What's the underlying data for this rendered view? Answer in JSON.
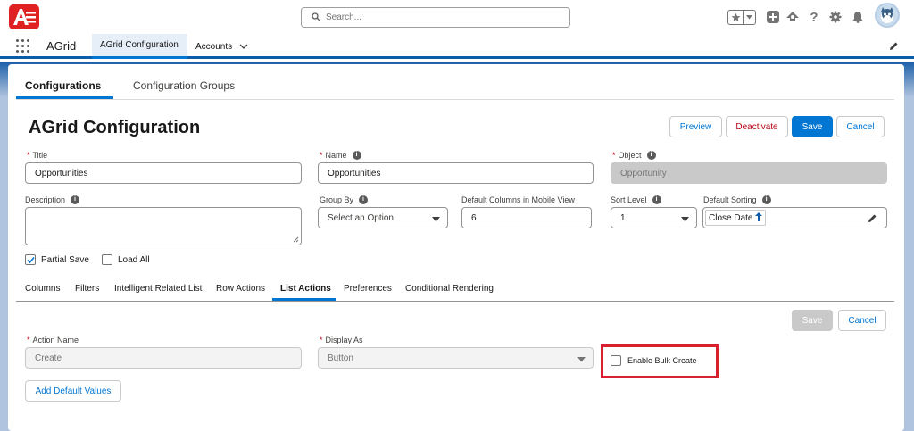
{
  "header": {
    "search_placeholder": "Search...",
    "icons": [
      "app-logo-icon",
      "search-icon",
      "favorites-star-icon",
      "chevron-down-icon",
      "add-icon",
      "trailhead-icon",
      "help-icon",
      "setup-gear-icon",
      "notifications-bell-icon",
      "avatar"
    ]
  },
  "nav": {
    "app_name": "AGrid",
    "tabs": [
      {
        "label": "AGrid Configuration",
        "active": true
      },
      {
        "label": "Accounts",
        "active": false
      }
    ]
  },
  "main_tabs": [
    {
      "label": "Configurations",
      "active": true
    },
    {
      "label": "Configuration Groups",
      "active": false
    }
  ],
  "page": {
    "title": "AGrid Configuration",
    "buttons": {
      "preview": "Preview",
      "deactivate": "Deactivate",
      "save": "Save",
      "cancel": "Cancel"
    }
  },
  "form": {
    "title_label": "Title",
    "title_value": "Opportunities",
    "name_label": "Name",
    "name_value": "Opportunities",
    "object_label": "Object",
    "object_value": "Opportunity",
    "description_label": "Description",
    "description_value": "",
    "group_by_label": "Group By",
    "group_by_value": "Select an Option",
    "default_columns_label": "Default Columns in Mobile View",
    "default_columns_value": "6",
    "sort_level_label": "Sort Level",
    "sort_level_value": "1",
    "default_sorting_label": "Default Sorting",
    "default_sorting_value": "Close Date",
    "partial_save_label": "Partial Save",
    "partial_save_checked": true,
    "load_all_label": "Load All",
    "load_all_checked": false
  },
  "sub_tabs": [
    {
      "label": "Columns",
      "active": false
    },
    {
      "label": "Filters",
      "active": false
    },
    {
      "label": "Intelligent Related List",
      "active": false
    },
    {
      "label": "Row Actions",
      "active": false
    },
    {
      "label": "List Actions",
      "active": true
    },
    {
      "label": "Preferences",
      "active": false
    },
    {
      "label": "Conditional Rendering",
      "active": false
    }
  ],
  "list_actions": {
    "save_label": "Save",
    "cancel_label": "Cancel",
    "action_name_label": "Action Name",
    "action_name_value": "Create",
    "display_as_label": "Display As",
    "display_as_value": "Button",
    "enable_bulk_create_label": "Enable Bulk Create",
    "enable_bulk_create_checked": false,
    "add_default_values_label": "Add Default Values"
  },
  "colors": {
    "brand": "#0176d3",
    "nav_band": "#0b5cab",
    "highlight": "#d7202b",
    "required": "#ba0517"
  }
}
